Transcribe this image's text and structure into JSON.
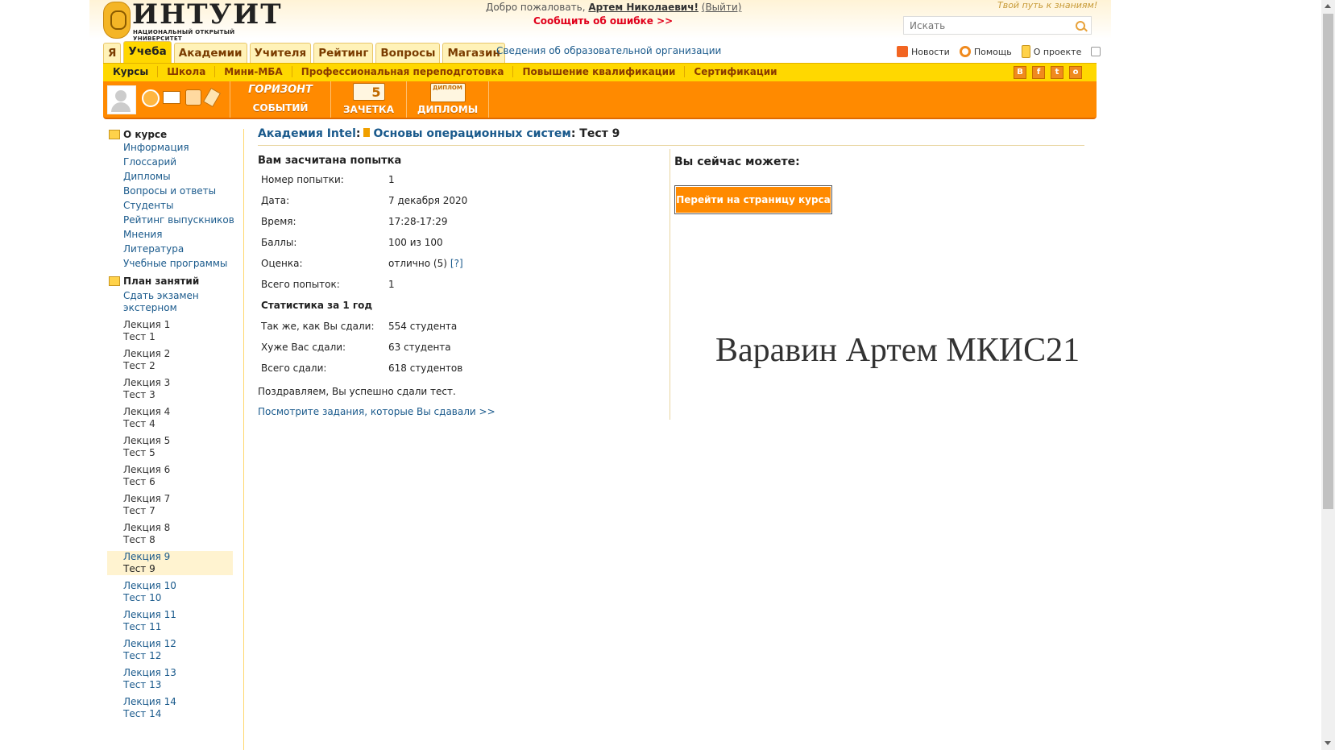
{
  "header": {
    "logo_title": "ИНТУИТ",
    "logo_subtitle": "НАЦИОНАЛЬНЫЙ ОТКРЫТЫЙ УНИВЕРСИТЕТ",
    "welcome_prefix": "Добро пожаловать,",
    "user_name": "Артем Николаевич!",
    "logout_label": "(Выйти)",
    "report_error": "Сообщить об ошибке >>",
    "slogan": "Твой путь к знаниям!",
    "search_placeholder": "Искать"
  },
  "tabs": [
    {
      "label": "Я",
      "active": false
    },
    {
      "label": "Учеба",
      "active": true
    },
    {
      "label": "Академии",
      "active": false
    },
    {
      "label": "Учителя",
      "active": false
    },
    {
      "label": "Рейтинг",
      "active": false
    },
    {
      "label": "Вопросы",
      "active": false
    },
    {
      "label": "Магазин",
      "active": false
    }
  ],
  "org_info_link": "Сведения об образовательной организации",
  "top_links": {
    "news": "Новости",
    "help": "Помощь",
    "about": "О проекте"
  },
  "menubar": [
    "Курсы",
    "Школа",
    "Мини-МБА",
    "Профессиональная переподготовка",
    "Повышение квалификации",
    "Сертификации"
  ],
  "social": [
    "В",
    "f",
    "t",
    "о"
  ],
  "toolbar": {
    "horizon": "СОБЫТИЙ",
    "horizon_top": "ГОРИЗОНТ",
    "gradebook": "ЗАЧЕТКА",
    "gradebook_digit": "5",
    "diplomas": "ДИПЛОМЫ",
    "diploma_pic": "ДИПЛОМ"
  },
  "sidebar": {
    "about_title": "О курсе",
    "about_links": [
      "Информация",
      "Глоссарий",
      "Дипломы",
      "Вопросы и ответы",
      "Студенты",
      "Рейтинг выпускников",
      "Мнения",
      "Литература",
      "Учебные программы"
    ],
    "plan_title": "План занятий",
    "exam": [
      "Сдать экзамен",
      "экстерном"
    ],
    "lessons": [
      {
        "lecture": "Лекция 1",
        "test": "Тест 1"
      },
      {
        "lecture": "Лекция 2",
        "test": "Тест 2"
      },
      {
        "lecture": "Лекция 3",
        "test": "Тест 3"
      },
      {
        "lecture": "Лекция 4",
        "test": "Тест 4"
      },
      {
        "lecture": "Лекция 5",
        "test": "Тест 5"
      },
      {
        "lecture": "Лекция 6",
        "test": "Тест 6"
      },
      {
        "lecture": "Лекция 7",
        "test": "Тест 7"
      },
      {
        "lecture": "Лекция 8",
        "test": "Тест 8"
      },
      {
        "lecture": "Лекция 9",
        "test": "Тест 9"
      },
      {
        "lecture": "Лекция 10",
        "test": "Тест 10"
      },
      {
        "lecture": "Лекция 11",
        "test": "Тест 11"
      },
      {
        "lecture": "Лекция 12",
        "test": "Тест 12"
      },
      {
        "lecture": "Лекция 13",
        "test": "Тест 13"
      },
      {
        "lecture": "Лекция 14",
        "test": "Тест 14"
      }
    ]
  },
  "breadcrumb": {
    "academy": "Академия Intel",
    "course": "Основы операционных систем",
    "current": "Тест 9"
  },
  "result": {
    "heading": "Вам засчитана попытка",
    "rows": [
      {
        "k": "Номер попытки:",
        "v": "1"
      },
      {
        "k": "Дата:",
        "v": "7 декабря 2020"
      },
      {
        "k": "Время:",
        "v": "17:28-17:29"
      },
      {
        "k": "Баллы:",
        "v": "100 из 100"
      },
      {
        "k": "Оценка:",
        "v": "отлично (5)",
        "link": "[?]"
      },
      {
        "k": "Всего попыток:",
        "v": "1"
      }
    ],
    "stats_title": "Статистика за 1 год",
    "stats": [
      {
        "k": "Так же, как Вы сдали:",
        "v": "554 студента"
      },
      {
        "k": "Хуже Вас сдали:",
        "v": "63 студента"
      },
      {
        "k": "Всего сдали:",
        "v": "618 студентов"
      }
    ],
    "congrats": "Поздравляем, Вы успешно сдали тест.",
    "view_tasks": "Посмотрите задания, которые Вы сдавали >>"
  },
  "actions": {
    "title": "Вы сейчас можете:",
    "go_course": "Перейти на страницу курса"
  },
  "overlay_text": "Варавин Артем МКИС21",
  "colors": {
    "accent_orange": "#ff8a00",
    "menu_yellow": "#ffd800",
    "link_blue": "#1a5a8c",
    "error_red": "#e0001b"
  }
}
